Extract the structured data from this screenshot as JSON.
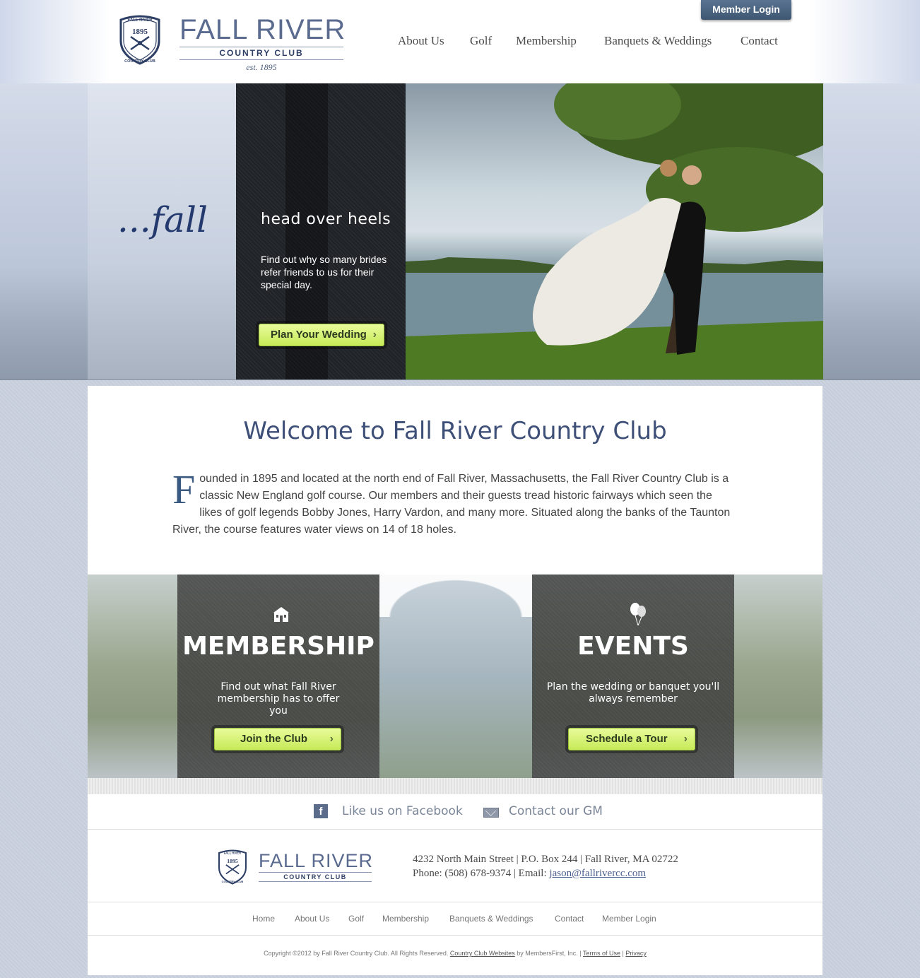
{
  "header": {
    "logo": {
      "crest_top": "FALL RIVER",
      "crest_year": "1895",
      "crest_bottom": "COUNTRY CLUB",
      "title": "FALL RIVER",
      "subtitle": "COUNTRY CLUB",
      "est": "est. 1895"
    },
    "member_login": "Member Login",
    "nav": [
      "About Us",
      "Golf",
      "Membership",
      "Banquets & Weddings",
      "Contact"
    ]
  },
  "hero": {
    "tagline": "...fall",
    "heading": "head over heels",
    "body": "Find out why so many brides refer friends to us for their special day.",
    "button": "Plan Your Wedding",
    "chevron": "›"
  },
  "welcome": {
    "title": "Welcome to Fall River Country Club",
    "dropcap": "F",
    "body": "ounded in 1895 and located at the north end of Fall River, Massachusetts, the Fall River Country Club is a classic New England golf course. Our members and their guests tread historic fairways which seen the likes of golf legends Bobby Jones, Harry Vardon, and many more. Situated along the banks of the Taunton River, the course features water views on 14 of 18 holes."
  },
  "promos": [
    {
      "icon": "clubhouse-icon",
      "title": "MEMBERSHIP",
      "text": "Find out what Fall River membership has to offer you",
      "button": "Join the Club"
    },
    {
      "icon": "balloons-icon",
      "title": "EVENTS",
      "text": "Plan the wedding or banquet you'll always remember",
      "button": "Schedule a Tour"
    }
  ],
  "social": {
    "facebook_icon": "f",
    "facebook": "Like us on Facebook",
    "contact": "Contact our GM"
  },
  "footer": {
    "logo_title": "FALL RIVER",
    "logo_subtitle": "COUNTRY CLUB",
    "address": "4232 North Main Street | P.O. Box 244 | Fall River, MA 02722",
    "phone_prefix": "Phone: (508) 678-9374 | Email: ",
    "email": "jason@fallrivercc.com",
    "nav": [
      "Home",
      "About Us",
      "Golf",
      "Membership",
      "Banquets & Weddings",
      "Contact",
      "Member Login"
    ],
    "copyright_prefix": "Copyright ©2012 by Fall River Country Club. All Rights Reserved.",
    "cc_websites": "Country Club Websites",
    "by": "by MembersFirst, Inc. |",
    "terms": "Terms of Use",
    "sep": "|",
    "privacy": "Privacy"
  },
  "colors": {
    "brand_navy": "#2e3f66",
    "logo_blue": "#5a6b8f",
    "button_green": "#c7ea58",
    "page_background": "#c9d0de"
  }
}
